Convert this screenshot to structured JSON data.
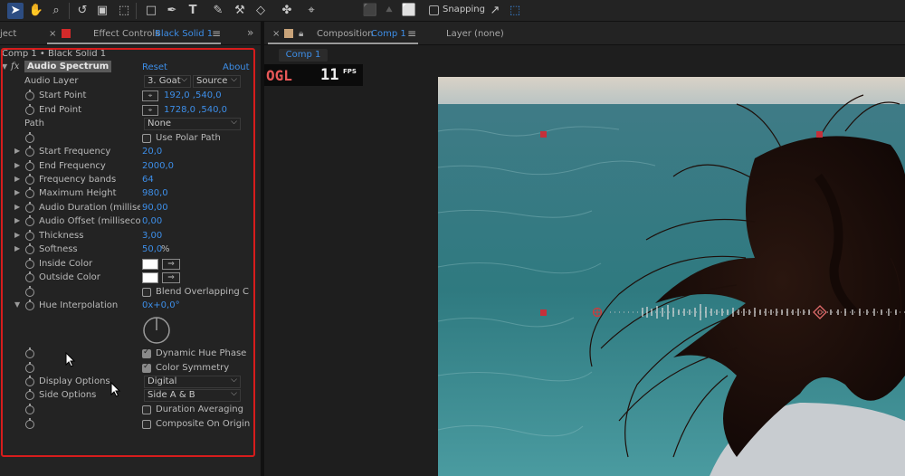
{
  "toolbar": {
    "icons": [
      "selection-tool-icon",
      "hand-tool-icon",
      "zoom-tool-icon",
      "rotate-tool-icon",
      "camera-tool-icon",
      "pan-behind-tool-icon",
      "rectangle-tool-icon",
      "pen-tool-icon",
      "type-tool-icon",
      "brush-tool-icon",
      "clone-stamp-tool-icon",
      "eraser-tool-icon",
      "roto-brush-tool-icon",
      "puppet-pin-tool-icon"
    ],
    "snapping_label": "Snapping",
    "accent": "#2d4d82"
  },
  "left_header": {
    "project_tab": "ject",
    "close_mark": "×",
    "effect_controls_label": "Effect Controls",
    "layer_name": "Black Solid 1",
    "menu_mark": "≡",
    "overflow_mark": "»"
  },
  "right_header": {
    "close_mark": "×",
    "composition_label": "Composition",
    "comp_name": "Comp 1",
    "menu_mark": "≡",
    "layer_label": "Layer (none)"
  },
  "effect_controls": {
    "title": "Comp 1 • Black Solid 1",
    "fx_mark": "fx",
    "effect_name": "Audio Spectrum",
    "reset": "Reset",
    "about": "About",
    "audio_layer_label": "Audio Layer",
    "audio_layer_value": "3. Goat",
    "audio_layer_source": "Source",
    "start_point_label": "Start Point",
    "start_point_value": "192,0 ,540,0",
    "end_point_label": "End Point",
    "end_point_value": "1728,0 ,540,0",
    "path_label": "Path",
    "path_value": "None",
    "use_polar_path": "Use Polar Path",
    "start_frequency_label": "Start Frequency",
    "start_frequency_value": "20,0",
    "end_frequency_label": "End Frequency",
    "end_frequency_value": "2000,0",
    "frequency_bands_label": "Frequency bands",
    "frequency_bands_value": "64",
    "maximum_height_label": "Maximum Height",
    "maximum_height_value": "980,0",
    "audio_duration_label": "Audio Duration (millisec",
    "audio_duration_value": "90,00",
    "audio_offset_label": "Audio Offset (millisecon",
    "audio_offset_value": "0,00",
    "thickness_label": "Thickness",
    "thickness_value": "3,00",
    "softness_label": "Softness",
    "softness_value": "50,0",
    "softness_unit": "%",
    "inside_color_label": "Inside Color",
    "outside_color_label": "Outside Color",
    "blend_overlapping": "Blend Overlapping C",
    "hue_interpolation_label": "Hue Interpolation",
    "hue_interpolation_value": "0x+0,0°",
    "dynamic_hue_phase": "Dynamic Hue Phase",
    "color_symmetry": "Color Symmetry",
    "display_options_label": "Display Options",
    "display_options_value": "Digital",
    "side_options_label": "Side Options",
    "side_options_value": "Side A & B",
    "duration_averaging": "Duration Averaging",
    "composite_on_original": "Composite On Origin",
    "outline_color": "#d71c1c"
  },
  "viewer": {
    "comp_tab": "Comp 1",
    "renderer": "OGL",
    "fps_value": "11",
    "fps_label": "FPS"
  }
}
